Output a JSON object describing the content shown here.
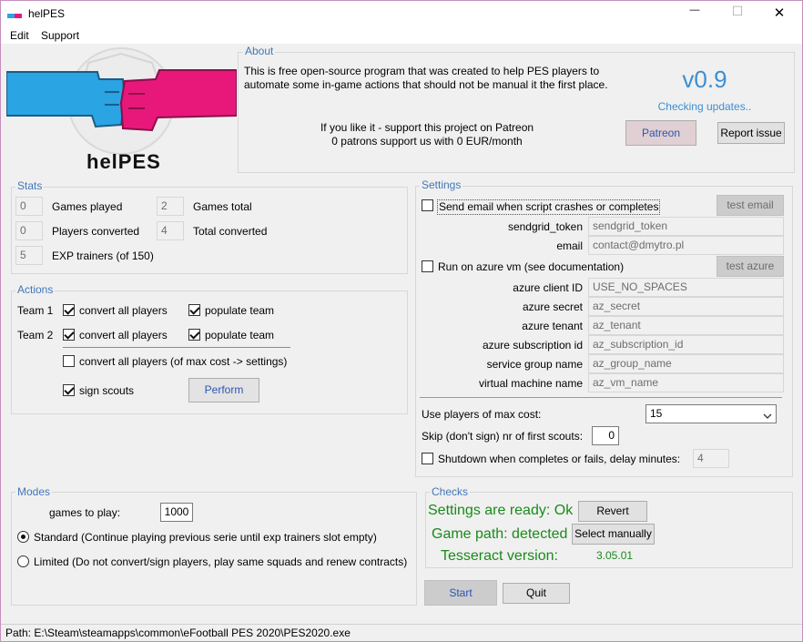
{
  "window": {
    "title": "helPES",
    "controls": {
      "minimize": "—",
      "maximize": "☐",
      "close": "✕"
    }
  },
  "menu": {
    "items": [
      "Edit",
      "Support"
    ]
  },
  "logo": {
    "text": "helPES",
    "colors": {
      "left_fist": "#2aa4e3",
      "right_fist": "#e8187a",
      "ball": "#e6e6e6"
    }
  },
  "about": {
    "title": "About",
    "description": "This is free open-source program that was created to help PES players to automate some in-game actions that should not be manual it the first place.",
    "support_line1": "If you like it - support this project on Patreon",
    "support_line2": "0 patrons support us with 0 EUR/month",
    "version": "v0.9",
    "update_status": "Checking updates..",
    "patreon_button": "Patreon",
    "report_button": "Report issue"
  },
  "stats": {
    "title": "Stats",
    "games_played_value": "0",
    "games_played_label": "Games played",
    "games_total_value": "2",
    "games_total_label": "Games total",
    "players_converted_value": "0",
    "players_converted_label": "Players converted",
    "total_converted_value": "4",
    "total_converted_label": "Total converted",
    "exp_trainers_value": "5",
    "exp_trainers_label": "EXP trainers (of 150)"
  },
  "actions": {
    "title": "Actions",
    "team1_label": "Team 1",
    "team2_label": "Team 2",
    "convert_all_label": "convert all players",
    "populate_team_label": "populate team",
    "convert_max_cost_label": "convert all players (of max cost -> settings)",
    "sign_scouts_label": "sign scouts",
    "perform_button": "Perform"
  },
  "settings": {
    "title": "Settings",
    "send_email_label": "Send email when script crashes or completes",
    "test_email_button": "test email",
    "sendgrid_token_label": "sendgrid_token",
    "sendgrid_token_value": "sendgrid_token",
    "email_label": "email",
    "email_value": "contact@dmytro.pl",
    "run_azure_label": "Run on azure vm (see documentation)",
    "test_azure_button": "test azure",
    "azure_client_id_label": "azure client ID",
    "azure_client_id_value": "USE_NO_SPACES",
    "azure_secret_label": "azure secret",
    "azure_secret_value": "az_secret",
    "azure_tenant_label": "azure tenant",
    "azure_tenant_value": "az_tenant",
    "azure_subscription_label": "azure subscription id",
    "azure_subscription_value": "az_subscription_id",
    "service_group_label": "service group name",
    "service_group_value": "az_group_name",
    "vm_name_label": "virtual machine name",
    "vm_name_value": "az_vm_name",
    "max_cost_label": "Use players of max cost:",
    "max_cost_value": "15",
    "skip_scouts_label": "Skip (don't sign) nr of first scouts:",
    "skip_scouts_value": "0",
    "shutdown_label": "Shutdown when completes or fails, delay minutes:",
    "shutdown_delay_value": "4"
  },
  "modes": {
    "title": "Modes",
    "games_to_play_label": "games to play:",
    "games_to_play_value": "1000",
    "standard_label": "Standard (Continue playing previous serie until exp trainers slot empty)",
    "limited_label": "Limited (Do not convert/sign players, play same squads and renew contracts)"
  },
  "checks": {
    "title": "Checks",
    "settings_ready": "Settings are ready: Ok",
    "revert_button": "Revert",
    "game_path": "Game path: detected",
    "select_manually_button": "Select manually",
    "tesseract_label": "Tesseract version:",
    "tesseract_value": "3.05.01"
  },
  "buttons": {
    "start": "Start",
    "quit": "Quit"
  },
  "status_bar": {
    "path": "Path: E:\\Steam\\steamapps\\common\\eFootball PES 2020\\PES2020.exe"
  }
}
